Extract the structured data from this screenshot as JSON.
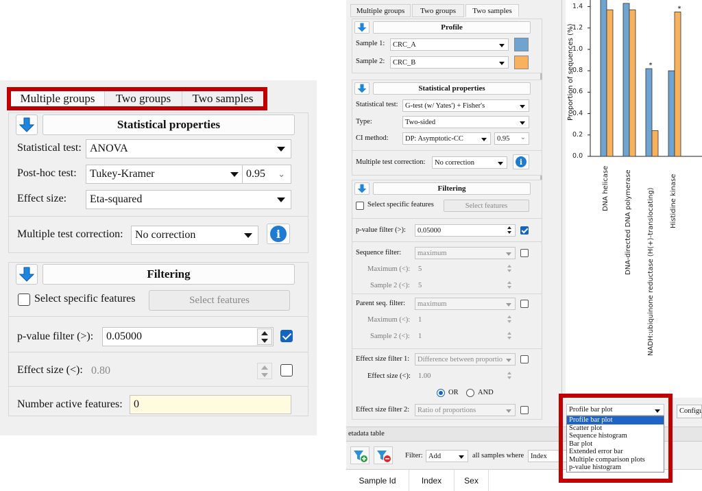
{
  "left_panel": {
    "tabs": [
      "Multiple groups",
      "Two groups",
      "Two samples"
    ],
    "statistical_properties": {
      "header": "Statistical properties",
      "statistical_test_label": "Statistical test:",
      "statistical_test_value": "ANOVA",
      "post_hoc_label": "Post-hoc test:",
      "post_hoc_value": "Tukey-Kramer",
      "post_hoc_ci": "0.95",
      "effect_size_label": "Effect size:",
      "effect_size_value": "Eta-squared",
      "multiple_test_label": "Multiple test correction:",
      "multiple_test_value": "No correction"
    },
    "filtering": {
      "header": "Filtering",
      "select_specific_label": "Select specific features",
      "select_features_button": "Select features",
      "p_value_label": "p-value filter (>):",
      "p_value_value": "0.05000",
      "effect_size_label": "Effect size (<):",
      "effect_size_value": "0.80",
      "active_features_label": "Number active features:",
      "active_features_value": "0"
    }
  },
  "right_panel": {
    "tabs": [
      "Multiple groups",
      "Two groups",
      "Two samples"
    ],
    "profile": {
      "header": "Profile",
      "sample1_label": "Sample 1:",
      "sample1_value": "CRC_A",
      "sample2_label": "Sample 2:",
      "sample2_value": "CRC_B",
      "sample1_color": "#6fa3d0",
      "sample2_color": "#f8b15c"
    },
    "statistical_properties": {
      "header": "Statistical properties",
      "statistical_test_label": "Statistical test:",
      "statistical_test_value": "G-test (w/ Yates') + Fisher's",
      "type_label": "Type:",
      "type_value": "Two-sided",
      "ci_method_label": "CI method:",
      "ci_method_value": "DP: Asymptotic-CC",
      "ci_value": "0.95",
      "multiple_test_label": "Multiple test correction:",
      "multiple_test_value": "No correction"
    },
    "filtering": {
      "header": "Filtering",
      "select_specific_label": "Select specific features",
      "select_features_button": "Select features",
      "p_value_label": "p-value filter (>):",
      "p_value_value": "0.05000",
      "sequence_filter_label": "Sequence filter:",
      "sequence_filter_value": "maximum",
      "maximum_label": "Maximum (<):",
      "maximum_value": "5",
      "sample2_label": "Sample 2 (<):",
      "sample2_value": "5",
      "parent_seq_label": "Parent seq. filter:",
      "parent_seq_value": "maximum",
      "parent_max_label": "Maximum (<):",
      "parent_max_value": "1",
      "parent_sample2_label": "Sample 2 (<):",
      "parent_sample2_value": "1",
      "effect1_label": "Effect size filter 1:",
      "effect1_value": "Difference between proportio",
      "effect_size_label": "Effect size (<):",
      "effect_size_value": "1.00",
      "or_label": "OR",
      "and_label": "AND",
      "effect2_label": "Effect size filter 2:",
      "effect2_value": "Ratio of proportions"
    },
    "metadata": {
      "title": "etadata table",
      "filter_label": "Filter:",
      "filter_value": "Add",
      "where_label": "all samples where",
      "where_value": "Index",
      "columns": [
        "Sample Id",
        "Index",
        "Sex"
      ]
    },
    "plot_selector": {
      "current": "Profile bar plot",
      "configure_label": "Configure",
      "options": [
        "Profile bar plot",
        "Scatter plot",
        "Sequence histogram",
        "Bar plot",
        "Extended error bar",
        "Multiple comparison plots",
        "p-value histogram"
      ]
    }
  },
  "chart_data": {
    "type": "bar",
    "ylabel": "Proportion of sequences (%)",
    "yticks": [
      "0.0",
      "0.2",
      "0.4",
      "0.6",
      "0.8",
      "1.0",
      "1.2",
      "1.4"
    ],
    "ylim": [
      0,
      1.5
    ],
    "categories": [
      "DNA helicase",
      "DNA-directed DNA polymerase",
      "NADH:ubiquinone reductase (H(+)-translocating)",
      "Histidine kinase"
    ],
    "series": [
      {
        "name": "CRC_A",
        "color": "#6fa3d0",
        "values": [
          1.5,
          1.43,
          0.82,
          0.8
        ]
      },
      {
        "name": "CRC_B",
        "color": "#f8b15c",
        "values": [
          1.37,
          1.37,
          0.24,
          1.35
        ]
      }
    ],
    "significance_markers": [
      "",
      "*",
      "*",
      "*"
    ]
  }
}
